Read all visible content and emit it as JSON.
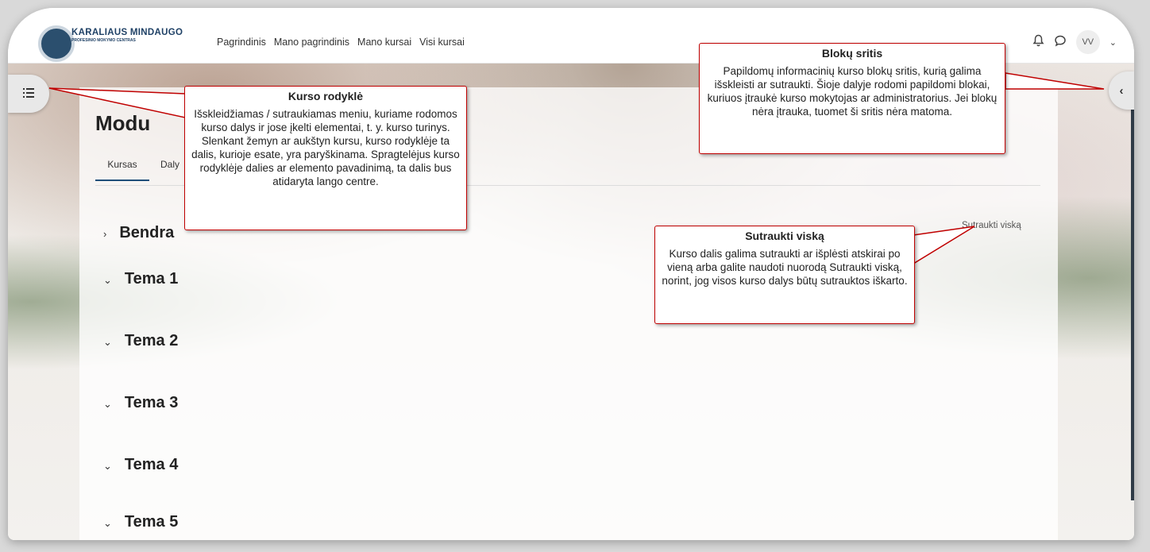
{
  "navbar": {
    "logo_title": "KARALIAUS MINDAUGO",
    "logo_subtitle": "PROFESINIO MOKYMO CENTRAS",
    "links": [
      "Pagrindinis",
      "Mano pagrindinis",
      "Mano kursai",
      "Visi kursai"
    ],
    "notification_icon": "bell-icon",
    "messages_icon": "chat-bubble-icon",
    "user_initials": "VV"
  },
  "course": {
    "title_partial": "Modu",
    "tabs": [
      "Kursas",
      "Daly"
    ],
    "collapse_all": "Sutraukti viską",
    "sections": [
      {
        "label": "Bendra",
        "chevron": "›"
      },
      {
        "label": "Tema 1",
        "chevron": "⌄"
      },
      {
        "label": "Tema 2",
        "chevron": "⌄"
      },
      {
        "label": "Tema 3",
        "chevron": "⌄"
      },
      {
        "label": "Tema 4",
        "chevron": "⌄"
      },
      {
        "label": "Tema 5",
        "chevron": "⌄"
      }
    ]
  },
  "drawers": {
    "left_icon": "course-index-icon",
    "right_icon": "chevron-left-icon"
  },
  "callouts": {
    "course_index": {
      "title": "Kurso rodyklė",
      "body": "Išskleidžiamas / sutraukiamas meniu, kuriame rodomos kurso dalys ir jose įkelti elementai, t. y. kurso turinys. Slenkant žemyn ar aukštyn kursu, kurso rodyklėje ta dalis, kurioje esate, yra paryškinama. Spragtelėjus kurso rodyklėje dalies ar elemento pavadinimą, ta dalis bus atidaryta lango centre."
    },
    "blocks_area": {
      "title": "Blokų sritis",
      "body": "Papildomų informacinių kurso blokų sritis, kurią galima išskleisti ar sutraukti. Šioje dalyje rodomi papildomi blokai, kuriuos įtraukė kurso mokytojas ar administratorius. Jei blokų nėra įtrauka, tuomet ši sritis nėra matoma."
    },
    "collapse_all": {
      "title": "Sutraukti viską",
      "body": "Kurso dalis galima sutraukti ar išplėsti atskirai po vieną arba galite naudoti nuorodą Sutraukti viską, norint, jog visos kurso dalys būtų sutrauktos iškarto."
    }
  },
  "colors": {
    "callout_border": "#c00000",
    "brand": "#1f4166",
    "active_tab": "#1f4e79"
  }
}
